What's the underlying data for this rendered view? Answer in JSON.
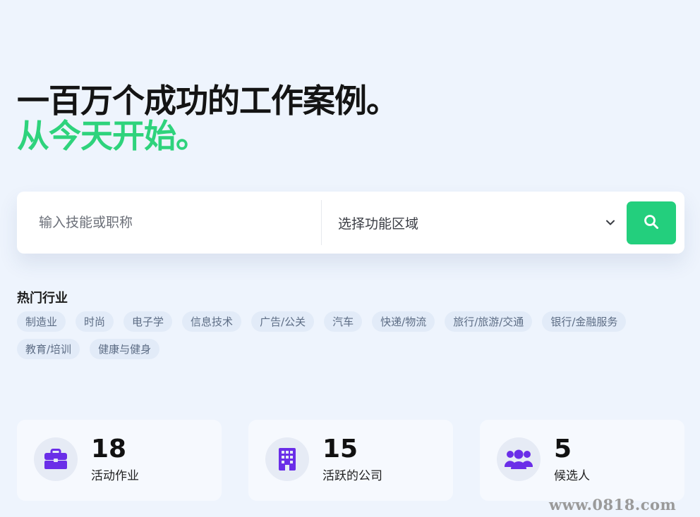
{
  "hero": {
    "line1": "一百万个成功的工作案例。",
    "line2": "从今天开始。"
  },
  "search": {
    "keyword_placeholder": "输入技能或职称",
    "area_value": "选择功能区域",
    "chevron_icon": "chevron-down-icon",
    "button_icon": "search-icon"
  },
  "hot": {
    "title": "热门行业",
    "tags": [
      "制造业",
      "时尚",
      "电子学",
      "信息技术",
      "广告/公关",
      "汽车",
      "快递/物流",
      "旅行/旅游/交通",
      "银行/金融服务",
      "教育/培训",
      "健康与健身"
    ]
  },
  "stats": [
    {
      "icon": "briefcase-icon",
      "value": "18",
      "label": "活动作业"
    },
    {
      "icon": "building-icon",
      "value": "15",
      "label": "活跃的公司"
    },
    {
      "icon": "users-icon",
      "value": "5",
      "label": "候选人"
    }
  ],
  "watermark": "www.0818.com",
  "colors": {
    "accent_green": "#23cf7d",
    "hero_green": "#2ed37c",
    "icon_purple": "#6a2ee8",
    "background": "#eef4fd"
  }
}
